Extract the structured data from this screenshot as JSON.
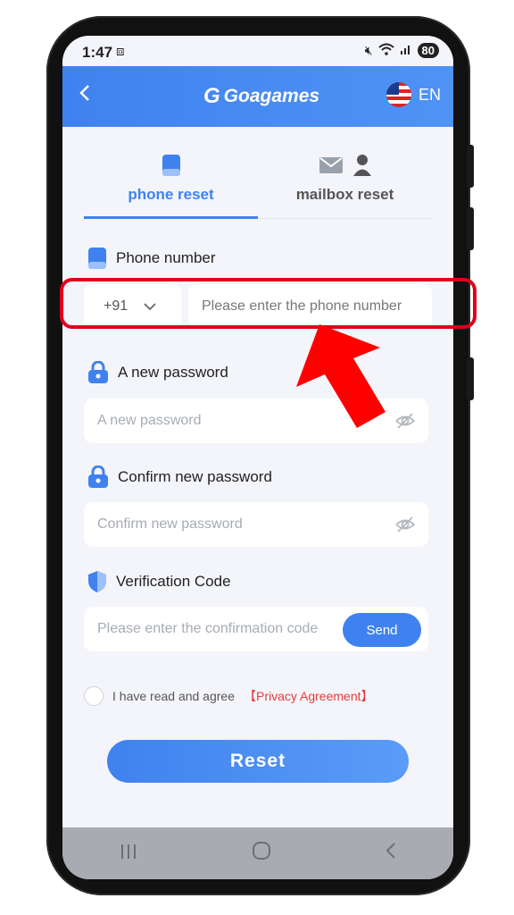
{
  "status": {
    "time": "1:47",
    "battery": "80"
  },
  "header": {
    "app_name": "Goagames",
    "language": "EN"
  },
  "tabs": [
    {
      "label": "phone reset",
      "active": true
    },
    {
      "label": "mailbox reset",
      "active": false
    }
  ],
  "form": {
    "phone_label": "Phone number",
    "country_code": "+91",
    "phone_placeholder": "Please enter the phone number",
    "new_password_label": "A new password",
    "new_password_placeholder": "A new password",
    "confirm_password_label": "Confirm new password",
    "confirm_password_placeholder": "Confirm new password",
    "code_label": "Verification Code",
    "code_placeholder": "Please enter the confirmation code",
    "send_label": "Send"
  },
  "agreement": {
    "text": "I have read and agree",
    "link": "【Privacy Agreement】"
  },
  "reset_label": "Reset",
  "colors": {
    "accent": "#3f82ef",
    "alert": "#e0001a",
    "link": "#e83a3a"
  }
}
